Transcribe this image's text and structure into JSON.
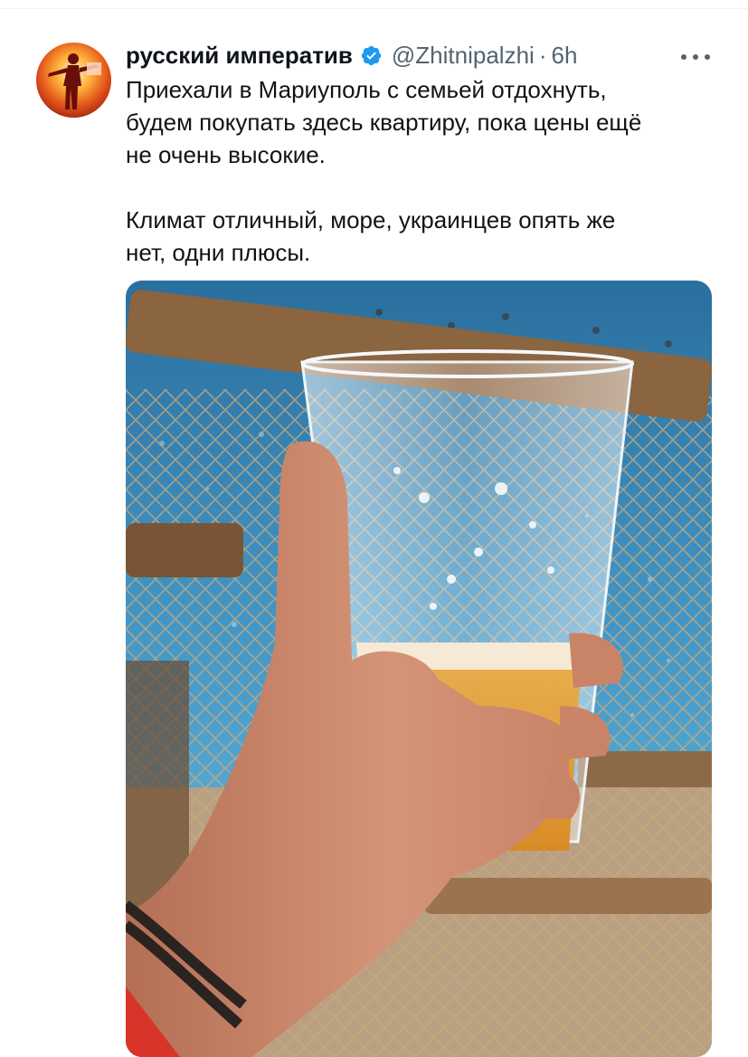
{
  "tweet": {
    "display_name": "русский императив",
    "handle": "@Zhitnipalzhi",
    "separator": "·",
    "time": "6h",
    "text": "Приехали в Мариуполь с семьей отдохнуть,\nбудем покупать здесь квартиру, пока цены ещё\nне очень высокие.\n\nКлимат отличный, море, украинцев опять же\nнет, одни плюсы.",
    "verified_icon": "verified-badge-icon",
    "more_icon": "more-options-icon"
  },
  "colors": {
    "text_primary": "#0f1419",
    "text_secondary": "#536471",
    "verified_blue": "#1d9bf0",
    "divider": "#eff3f4"
  }
}
